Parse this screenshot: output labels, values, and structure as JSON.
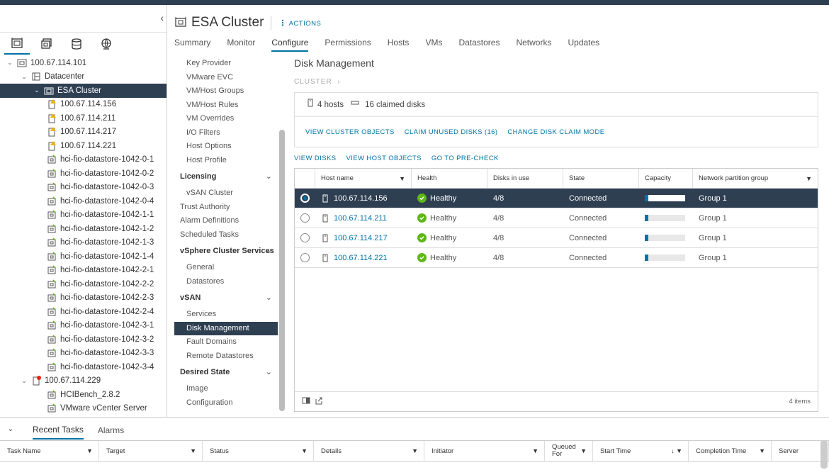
{
  "navigator": {
    "tree": [
      {
        "label": "100.67.114.101",
        "level": 0,
        "icon": "vcenter-icon",
        "expanded": true
      },
      {
        "label": "Datacenter",
        "level": 1,
        "icon": "datacenter-icon",
        "expanded": true
      },
      {
        "label": "ESA Cluster",
        "level": 2,
        "icon": "cluster-icon",
        "expanded": true,
        "selected": true
      },
      {
        "label": "100.67.114.156",
        "level": 3,
        "icon": "host-warning-icon"
      },
      {
        "label": "100.67.114.211",
        "level": 3,
        "icon": "host-warning-icon"
      },
      {
        "label": "100.67.114.217",
        "level": 3,
        "icon": "host-warning-icon"
      },
      {
        "label": "100.67.114.221",
        "level": 3,
        "icon": "host-warning-icon"
      },
      {
        "label": "hci-fio-datastore-1042-0-1",
        "level": 3,
        "icon": "vm-icon"
      },
      {
        "label": "hci-fio-datastore-1042-0-2",
        "level": 3,
        "icon": "vm-icon"
      },
      {
        "label": "hci-fio-datastore-1042-0-3",
        "level": 3,
        "icon": "vm-icon"
      },
      {
        "label": "hci-fio-datastore-1042-0-4",
        "level": 3,
        "icon": "vm-icon"
      },
      {
        "label": "hci-fio-datastore-1042-1-1",
        "level": 3,
        "icon": "vm-icon"
      },
      {
        "label": "hci-fio-datastore-1042-1-2",
        "level": 3,
        "icon": "vm-icon"
      },
      {
        "label": "hci-fio-datastore-1042-1-3",
        "level": 3,
        "icon": "vm-icon"
      },
      {
        "label": "hci-fio-datastore-1042-1-4",
        "level": 3,
        "icon": "vm-icon"
      },
      {
        "label": "hci-fio-datastore-1042-2-1",
        "level": 3,
        "icon": "vm-icon"
      },
      {
        "label": "hci-fio-datastore-1042-2-2",
        "level": 3,
        "icon": "vm-icon"
      },
      {
        "label": "hci-fio-datastore-1042-2-3",
        "level": 3,
        "icon": "vm-icon"
      },
      {
        "label": "hci-fio-datastore-1042-2-4",
        "level": 3,
        "icon": "vm-icon"
      },
      {
        "label": "hci-fio-datastore-1042-3-1",
        "level": 3,
        "icon": "vm-icon"
      },
      {
        "label": "hci-fio-datastore-1042-3-2",
        "level": 3,
        "icon": "vm-icon"
      },
      {
        "label": "hci-fio-datastore-1042-3-3",
        "level": 3,
        "icon": "vm-icon"
      },
      {
        "label": "hci-fio-datastore-1042-3-4",
        "level": 3,
        "icon": "vm-icon"
      },
      {
        "label": "100.67.114.229",
        "level": 1,
        "icon": "host-error-icon",
        "expanded": true
      },
      {
        "label": "HCIBench_2.8.2",
        "level": 3,
        "icon": "vm-icon"
      },
      {
        "label": "VMware vCenter Server",
        "level": 3,
        "icon": "vm-icon"
      }
    ]
  },
  "header": {
    "title": "ESA Cluster",
    "actions_label": "ACTIONS",
    "tabs": [
      "Summary",
      "Monitor",
      "Configure",
      "Permissions",
      "Hosts",
      "VMs",
      "Datastores",
      "Networks",
      "Updates"
    ],
    "active_tab": "Configure"
  },
  "config_menu": [
    {
      "type": "item",
      "label": "Key Provider"
    },
    {
      "type": "item",
      "label": "VMware EVC"
    },
    {
      "type": "item",
      "label": "VM/Host Groups"
    },
    {
      "type": "item",
      "label": "VM/Host Rules"
    },
    {
      "type": "item",
      "label": "VM Overrides"
    },
    {
      "type": "item",
      "label": "I/O Filters"
    },
    {
      "type": "item",
      "label": "Host Options"
    },
    {
      "type": "item",
      "label": "Host Profile"
    },
    {
      "type": "group",
      "label": "Licensing"
    },
    {
      "type": "item",
      "label": "vSAN Cluster"
    },
    {
      "type": "top",
      "label": "Trust Authority"
    },
    {
      "type": "top",
      "label": "Alarm Definitions"
    },
    {
      "type": "top",
      "label": "Scheduled Tasks"
    },
    {
      "type": "group",
      "label": "vSphere Cluster Services"
    },
    {
      "type": "item",
      "label": "General"
    },
    {
      "type": "item",
      "label": "Datastores"
    },
    {
      "type": "group",
      "label": "vSAN"
    },
    {
      "type": "item",
      "label": "Services"
    },
    {
      "type": "item",
      "label": "Disk Management",
      "active": true
    },
    {
      "type": "item",
      "label": "Fault Domains"
    },
    {
      "type": "item",
      "label": "Remote Datastores"
    },
    {
      "type": "group",
      "label": "Desired State"
    },
    {
      "type": "item",
      "label": "Image"
    },
    {
      "type": "item",
      "label": "Configuration"
    }
  ],
  "main": {
    "title": "Disk Management",
    "breadcrumb": "CLUSTER",
    "summary_hosts": "4 hosts",
    "summary_disks": "16 claimed disks",
    "summary_links": [
      "VIEW CLUSTER OBJECTS",
      "CLAIM UNUSED DISKS (16)",
      "CHANGE DISK CLAIM MODE"
    ],
    "table_links": [
      "VIEW DISKS",
      "VIEW HOST OBJECTS",
      "GO TO PRE-CHECK"
    ],
    "columns": [
      "Host name",
      "Health",
      "Disks in use",
      "State",
      "Capacity",
      "Network partition group"
    ],
    "rows": [
      {
        "host": "100.67.114.156",
        "health": "Healthy",
        "disks": "4/8",
        "state": "Connected",
        "capacity": 0.09,
        "group": "Group 1",
        "selected": true
      },
      {
        "host": "100.67.114.211",
        "health": "Healthy",
        "disks": "4/8",
        "state": "Connected",
        "capacity": 0.09,
        "group": "Group 1"
      },
      {
        "host": "100.67.114.217",
        "health": "Healthy",
        "disks": "4/8",
        "state": "Connected",
        "capacity": 0.09,
        "group": "Group 1"
      },
      {
        "host": "100.67.114.221",
        "health": "Healthy",
        "disks": "4/8",
        "state": "Connected",
        "capacity": 0.09,
        "group": "Group 1"
      }
    ],
    "item_count": "4 items"
  },
  "bottom": {
    "tabs": [
      "Recent Tasks",
      "Alarms"
    ],
    "active_tab": "Recent Tasks",
    "columns": [
      "Task Name",
      "Target",
      "Status",
      "Details",
      "Initiator",
      "Queued For",
      "Start Time",
      "Completion Time",
      "Server"
    ]
  },
  "colors": {
    "accent": "#0072a3",
    "selected_bg": "#2f3f52",
    "healthy": "#5eb715",
    "warning": "#f0b400",
    "error": "#e62700"
  }
}
